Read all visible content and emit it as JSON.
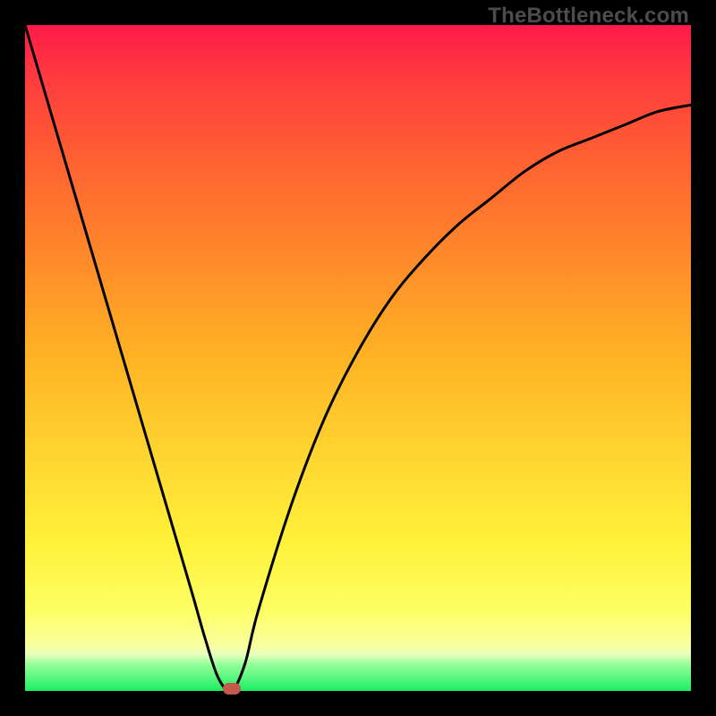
{
  "watermark": "TheBottleneck.com",
  "colors": {
    "frame": "#000000",
    "curve": "#000000",
    "marker": "#c35a4d"
  },
  "chart_data": {
    "type": "line",
    "title": "",
    "xlabel": "",
    "ylabel": "",
    "xlim": [
      0,
      100
    ],
    "ylim": [
      0,
      100
    ],
    "grid": false,
    "legend": false,
    "series": [
      {
        "name": "bottleneck-curve",
        "x": [
          0,
          5,
          10,
          15,
          20,
          25,
          27,
          29,
          31,
          33,
          35,
          40,
          45,
          50,
          55,
          60,
          65,
          70,
          75,
          80,
          85,
          90,
          95,
          100
        ],
        "y": [
          100,
          83,
          66,
          49,
          32,
          15,
          8,
          2,
          0,
          4,
          12,
          28,
          41,
          51,
          59,
          65,
          70,
          74,
          78,
          81,
          83,
          85,
          87,
          88
        ]
      }
    ],
    "marker": {
      "x": 31,
      "y": 0
    },
    "background_gradient": {
      "stops": [
        {
          "pct": 0,
          "color": "#ff1a49"
        },
        {
          "pct": 8,
          "color": "#ff3b3e"
        },
        {
          "pct": 20,
          "color": "#ff6032"
        },
        {
          "pct": 35,
          "color": "#ff8a2a"
        },
        {
          "pct": 50,
          "color": "#ffb324"
        },
        {
          "pct": 65,
          "color": "#ffd631"
        },
        {
          "pct": 78,
          "color": "#fff23a"
        },
        {
          "pct": 88,
          "color": "#fcff63"
        },
        {
          "pct": 93.2,
          "color": "#faffa0"
        },
        {
          "pct": 94.5,
          "color": "#e7ffbb"
        },
        {
          "pct": 96,
          "color": "#96ff9a"
        },
        {
          "pct": 100,
          "color": "#1bee62"
        }
      ]
    }
  }
}
